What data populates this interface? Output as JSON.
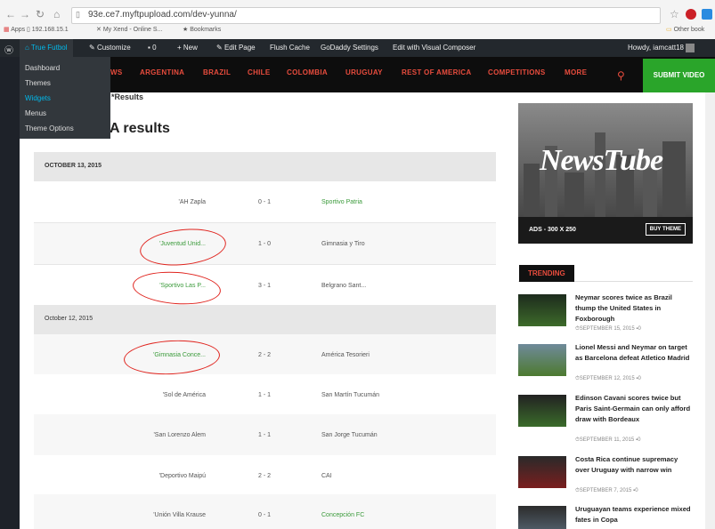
{
  "browser": {
    "url": "93e.ce7.myftpupload.com/dev-yunna/",
    "bookmarks": [
      "Apps",
      "192.168.15.1",
      "My Xend - Online S...",
      "Bookmarks"
    ],
    "other_bookmarks": "Other book"
  },
  "admin_bar": {
    "site": "True Futbol",
    "customize": "Customize",
    "comments": "0",
    "new": "New",
    "edit_page": "Edit Page",
    "flush_cache": "Flush Cache",
    "godaddy": "GoDaddy Settings",
    "visual_composer": "Edit with Visual Composer",
    "howdy": "Howdy, iamcatt18",
    "dropdown": [
      "Dashboard",
      "Themes",
      "Widgets",
      "Menus",
      "Theme Options"
    ]
  },
  "site_nav": {
    "items": [
      "WS",
      "ARGENTINA",
      "BRAZIL",
      "CHILE",
      "COLOMBIA",
      "URUGUAY",
      "REST OF AMERICA",
      "COMPETITIONS",
      "MORE"
    ],
    "submit": "SUBMIT VIDEO"
  },
  "breadcrumb": "*Results",
  "page_title": "A results",
  "results": [
    {
      "date": "OCTOBER 13, 2015",
      "matches": [
        {
          "home": "'AH Zapla",
          "score": "0 - 1",
          "away": "Sportivo Patria",
          "away_green": true
        },
        {
          "home": "'Juventud Unid...",
          "score": "1 - 0",
          "away": "Gimnasia y Tiro",
          "home_green": true
        },
        {
          "home": "'Sportivo Las P...",
          "score": "3 - 1",
          "away": "Belgrano Sant...",
          "home_green": true
        }
      ]
    },
    {
      "date": "October 12, 2015",
      "matches": [
        {
          "home": "'Gimnasia Conce...",
          "score": "2 - 2",
          "away": "América Tesorieri",
          "home_green": true
        },
        {
          "home": "'Sol de América",
          "score": "1 - 1",
          "away": "San Martín Tucumán"
        },
        {
          "home": "'San Lorenzo Alem",
          "score": "1 - 1",
          "away": "San Jorge Tucumán"
        },
        {
          "home": "'Deportivo Maipú",
          "score": "2 - 2",
          "away": "CAI"
        },
        {
          "home": "'Unión Villa Krause",
          "score": "0 - 1",
          "away": "Concepción FC",
          "away_green": true
        }
      ]
    }
  ],
  "ad": {
    "logo": "NewsTube",
    "size": "ADS - 300 X 250",
    "button": "BUY THEME"
  },
  "trending": {
    "label": "TRENDING",
    "items": [
      {
        "title": "Neymar scores twice as Brazil thump the United States in Foxborough",
        "date": "SEPTEMBER 15, 2015",
        "comments": "0"
      },
      {
        "title": "Lionel Messi and Neymar on target as Barcelona defeat Atletico Madrid",
        "date": "SEPTEMBER 12, 2015",
        "comments": "0"
      },
      {
        "title": "Edinson Cavani scores twice but Paris Saint-Germain can only afford draw with Bordeaux",
        "date": "SEPTEMBER 11, 2015",
        "comments": "0"
      },
      {
        "title": "Costa Rica continue supremacy over Uruguay with narrow win",
        "date": "SEPTEMBER 7, 2015",
        "comments": "0"
      },
      {
        "title": "Uruguayan teams experience mixed fates in Copa",
        "date": "",
        "comments": ""
      }
    ]
  }
}
